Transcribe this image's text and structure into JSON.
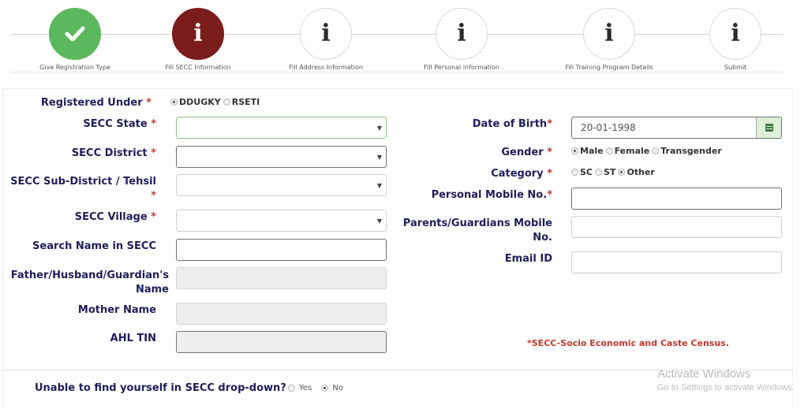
{
  "wizard": {
    "steps": [
      {
        "label": "Give Registration Type",
        "status": "done",
        "icon": "check-icon"
      },
      {
        "label": "Fill SECC Information",
        "status": "active",
        "icon": "info-icon"
      },
      {
        "label": "Fill Address Information",
        "status": "pending",
        "icon": "info-icon"
      },
      {
        "label": "Fill Personal information",
        "status": "pending",
        "icon": "info-icon"
      },
      {
        "label": "Fill Training Program Details",
        "status": "pending",
        "icon": "info-icon"
      },
      {
        "label": "Submit",
        "status": "pending",
        "icon": "info-icon"
      }
    ],
    "colors": {
      "done": "#5cb85c",
      "active": "#7b1c1c"
    }
  },
  "form": {
    "registered_under": {
      "label": "Registered Under",
      "required_mark": "*",
      "options": [
        "DDUGKY",
        "RSETI"
      ],
      "selected": "DDUGKY"
    },
    "secc_state": {
      "label": "SECC State",
      "required_mark": "*",
      "value": ""
    },
    "secc_district": {
      "label": "SECC District",
      "required_mark": "*",
      "value": ""
    },
    "secc_subdistrict": {
      "label": "SECC Sub-District / Tehsil",
      "required_mark": "*",
      "value": ""
    },
    "secc_village": {
      "label": "SECC Village",
      "required_mark": "*",
      "value": ""
    },
    "search_name": {
      "label": "Search Name in SECC",
      "value": ""
    },
    "father_name": {
      "label_line1": "Father/Husband/Guardian's",
      "label_line2": "Name",
      "value": ""
    },
    "mother_name": {
      "label": "Mother Name",
      "value": ""
    },
    "ahl_tin": {
      "label": "AHL TIN",
      "value": ""
    },
    "dob": {
      "label": "Date of Birth",
      "required_mark": "*",
      "value": "20-01-1998",
      "icon": "calendar-icon"
    },
    "gender": {
      "label": "Gender",
      "required_mark": "*",
      "options": [
        "Male",
        "Female",
        "Transgender"
      ],
      "selected": "Male"
    },
    "category": {
      "label": "Category",
      "required_mark": "*",
      "options": [
        "SC",
        "ST",
        "Other"
      ],
      "selected": "Other"
    },
    "personal_mobile": {
      "label": "Personal Mobile No.",
      "required_mark": "*",
      "value": ""
    },
    "parents_mobile": {
      "label_line1": "Parents/Guardians Mobile",
      "label_line2": "No.",
      "value": ""
    },
    "email": {
      "label": "Email ID",
      "value": ""
    },
    "note": "*SECC-Socio Economic and Caste Census.",
    "unable_to_find": {
      "label": "Unable to find yourself in SECC drop-down?",
      "options": [
        "Yes",
        "No"
      ],
      "selected": "No"
    }
  },
  "watermark": {
    "line1": "Activate Windows",
    "line2": "Go to Settings to activate Windows."
  }
}
